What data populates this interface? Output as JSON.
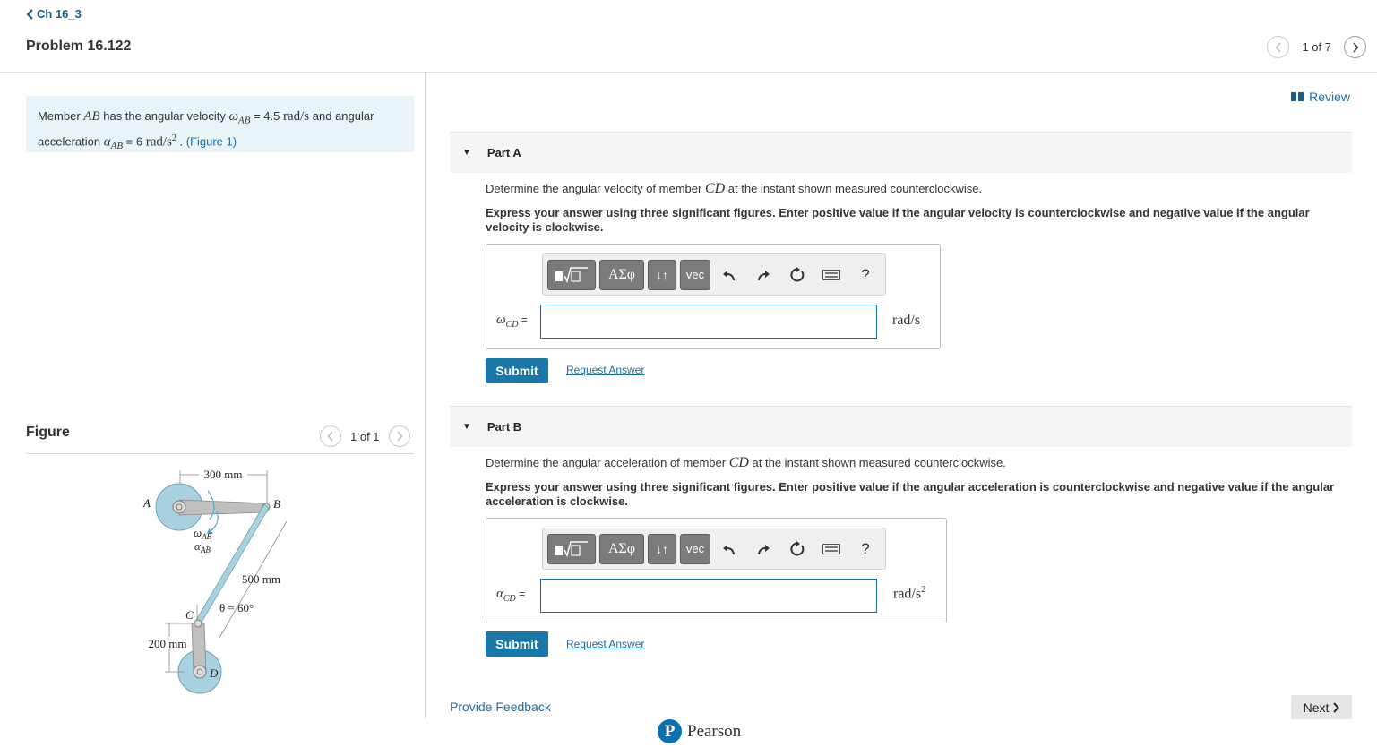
{
  "header": {
    "back_label": "Ch 16_3",
    "problem_title": "Problem 16.122",
    "pager_text": "1 of 7"
  },
  "statement": {
    "text_1": "Member ",
    "member_ab": "AB",
    "text_2": " has the angular velocity ",
    "omega": "ω",
    "sub_ab": "AB",
    "text_3": " = 4.5 ",
    "unit_rad_s": "rad/s",
    "text_4": " and angular acceleration ",
    "alpha": "α",
    "text_5": " = 6 ",
    "unit_rad_s2": "rad/s",
    "text_6": " . ",
    "figure_link": "(Figure 1)"
  },
  "figure": {
    "label": "Figure",
    "pager_text": "1 of 1",
    "labels": {
      "dim_300": "300 mm",
      "A": "A",
      "B": "B",
      "omega_ab": "ω",
      "alpha_ab": "α",
      "sub_ab": "AB",
      "dim_500": "500 mm",
      "theta": "θ = 60°",
      "C": "C",
      "dim_200": "200 mm",
      "D": "D"
    }
  },
  "review_label": "Review",
  "parts": [
    {
      "title": "Part A",
      "question_1": "Determine the angular velocity of member ",
      "question_member": "CD",
      "question_2": " at the instant shown measured counterclockwise.",
      "instructions": "Express your answer using three significant figures. Enter positive value if the angular velocity is counterclockwise and negative value if the angular velocity is clockwise.",
      "var_symbol": "ω",
      "var_sub": "CD",
      "equals": " =",
      "input_value": "",
      "unit": "rad/s",
      "submit_label": "Submit",
      "request_label": "Request Answer"
    },
    {
      "title": "Part B",
      "question_1": "Determine the angular acceleration of member ",
      "question_member": "CD",
      "question_2": " at the instant shown measured counterclockwise.",
      "instructions": "Express your answer using three significant figures. Enter positive value if the angular acceleration is counterclockwise and negative value if the angular acceleration is clockwise.",
      "var_symbol": "α",
      "var_sub": "CD",
      "equals": " =",
      "input_value": "",
      "unit": "rad/s",
      "submit_label": "Submit",
      "request_label": "Request Answer"
    }
  ],
  "toolbar": {
    "greek_label": "ΑΣφ",
    "arrows_label": "↓↑",
    "vec_label": "vec",
    "help_label": "?"
  },
  "footer": {
    "feedback_label": "Provide Feedback",
    "next_label": "Next",
    "brand": "Pearson",
    "brand_logo_letter": "P"
  },
  "colors": {
    "accent": "#1a78a8",
    "link": "#1a6fa3",
    "statement_bg": "#e8f4f7",
    "figure_disk": "#a8d2e2",
    "figure_link": "#bfbfbf"
  }
}
